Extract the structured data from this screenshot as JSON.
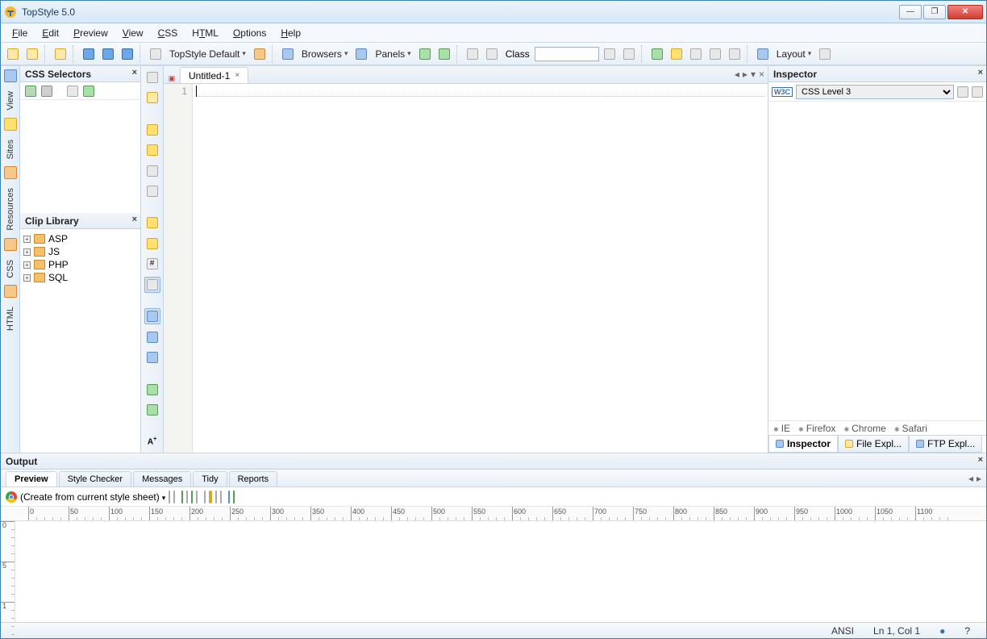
{
  "window": {
    "title": "TopStyle 5.0"
  },
  "menu": [
    "File",
    "Edit",
    "Preview",
    "View",
    "CSS",
    "HTML",
    "Options",
    "Help"
  ],
  "toolbar": {
    "style_scheme": "TopStyle Default",
    "browsers": "Browsers",
    "panels": "Panels",
    "class_label": "Class",
    "class_value": "",
    "layout": "Layout"
  },
  "left_tabs": [
    "View",
    "Sites",
    "Resources",
    "CSS",
    "HTML"
  ],
  "css_selectors": {
    "title": "CSS Selectors"
  },
  "clip_library": {
    "title": "Clip Library",
    "items": [
      "ASP",
      "JS",
      "PHP",
      "SQL"
    ]
  },
  "editor": {
    "tab": "Untitled-1",
    "line": "1"
  },
  "inspector": {
    "title": "Inspector",
    "level": "CSS Level 3",
    "browsers": [
      "IE",
      "Firefox",
      "Chrome",
      "Safari"
    ],
    "tabs": [
      "Inspector",
      "File Expl...",
      "FTP Expl..."
    ]
  },
  "output": {
    "title": "Output",
    "tabs": [
      "Preview",
      "Style Checker",
      "Messages",
      "Tidy",
      "Reports"
    ],
    "preview_source": "(Create from current style sheet)"
  },
  "status": {
    "encoding": "ANSI",
    "position": "Ln 1, Col 1",
    "help": "?"
  },
  "ruler_h": [
    0,
    50,
    100,
    150,
    200,
    250,
    300,
    350,
    400,
    450,
    500,
    550,
    600,
    650,
    700,
    750,
    800,
    850,
    900,
    950,
    1000,
    1050,
    1100
  ],
  "ruler_v": [
    0,
    5,
    1
  ]
}
